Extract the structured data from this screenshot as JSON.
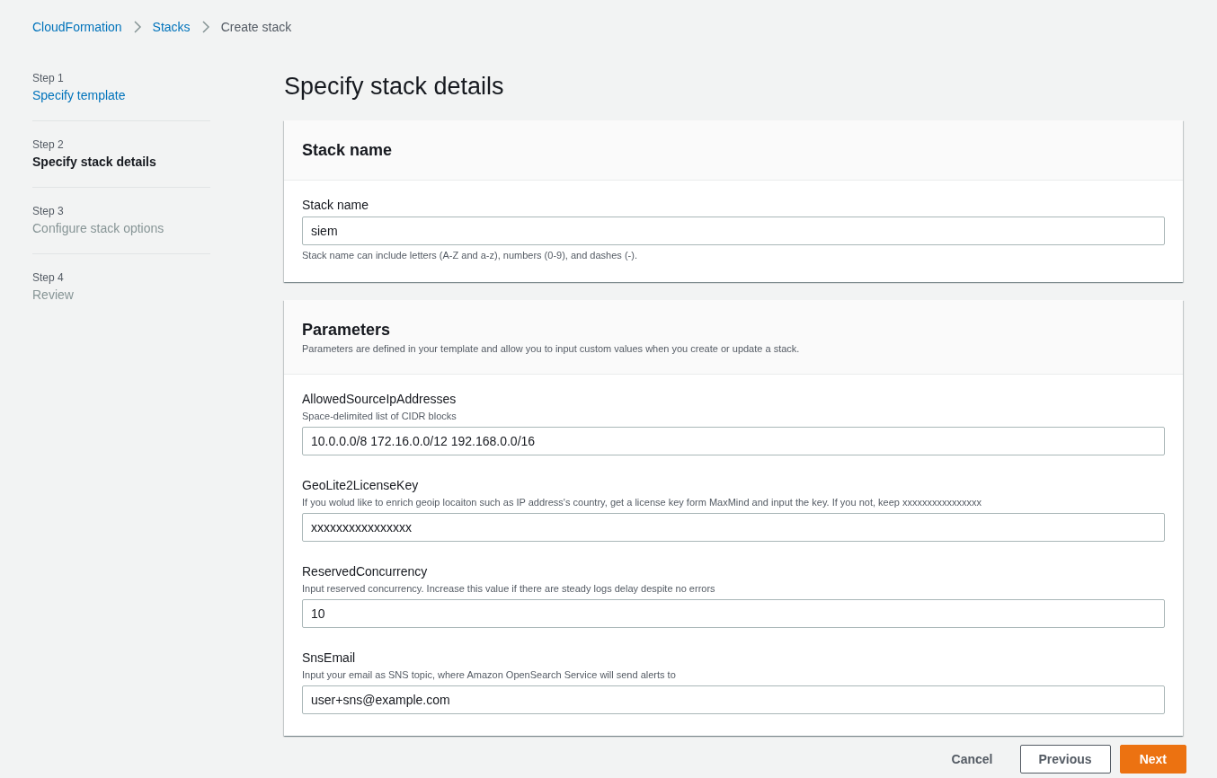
{
  "breadcrumb": [
    {
      "label": "CloudFormation",
      "link": true
    },
    {
      "label": "Stacks",
      "link": true
    },
    {
      "label": "Create stack",
      "link": false
    }
  ],
  "steps": [
    {
      "step": "Step 1",
      "label": "Specify template",
      "kind": "done"
    },
    {
      "step": "Step 2",
      "label": "Specify stack details",
      "kind": "current"
    },
    {
      "step": "Step 3",
      "label": "Configure stack options",
      "kind": "upcoming"
    },
    {
      "step": "Step 4",
      "label": "Review",
      "kind": "upcoming"
    }
  ],
  "page_title": "Specify stack details",
  "sections": [
    {
      "title": "Stack name",
      "fields": [
        {
          "label": "Stack name",
          "value": "siem",
          "hint": "Stack name can include letters (A-Z and a-z), numbers (0-9), and dashes (-)."
        }
      ]
    },
    {
      "title": "Parameters",
      "description": "Parameters are defined in your template and allow you to input custom values when you create or update a stack.",
      "fields": [
        {
          "label": "AllowedSourceIpAddresses",
          "description": "Space-delimited list of CIDR blocks",
          "value": "10.0.0.0/8 172.16.0.0/12 192.168.0.0/16"
        },
        {
          "label": "GeoLite2LicenseKey",
          "description": "If you wolud like to enrich geoip locaiton such as IP address's country, get a license key form MaxMind and input the key. If you not, keep xxxxxxxxxxxxxxxx",
          "value": "xxxxxxxxxxxxxxxx"
        },
        {
          "label": "ReservedConcurrency",
          "description": "Input reserved concurrency. Increase this value if there are steady logs delay despite no errors",
          "value": "10"
        },
        {
          "label": "SnsEmail",
          "description": "Input your email as SNS topic, where Amazon OpenSearch Service will send alerts to",
          "value": "user+sns@example.com"
        }
      ]
    }
  ],
  "buttons": [
    {
      "label": "Cancel",
      "kind": "link"
    },
    {
      "label": "Previous",
      "kind": "normal"
    },
    {
      "label": "Next",
      "kind": "primary"
    }
  ]
}
